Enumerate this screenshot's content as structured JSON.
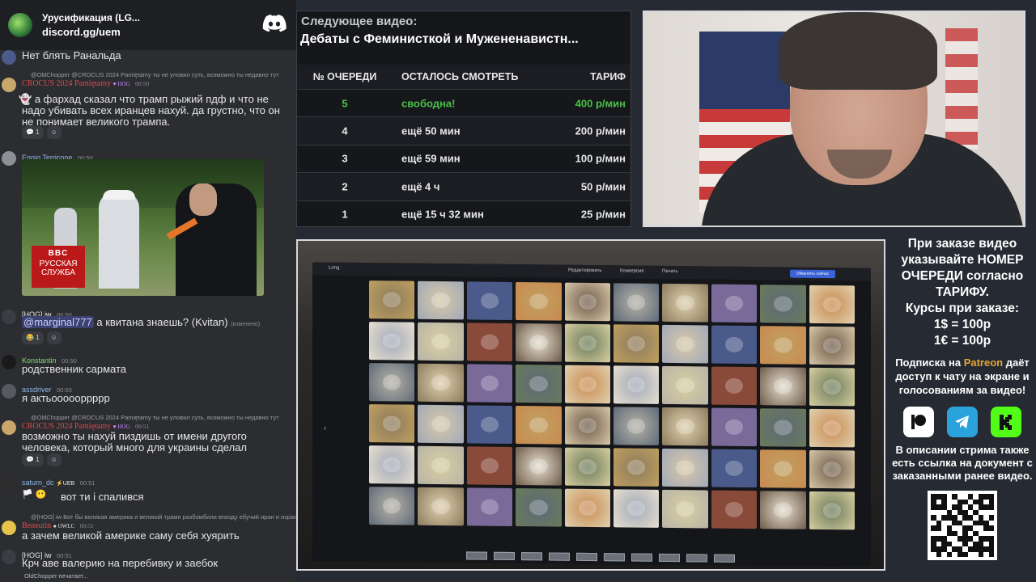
{
  "chat": {
    "server_name": "Урусификация (LG...",
    "server_link": "discord.gg/uem",
    "messages": [
      {
        "text": "Нет блять Ранальда"
      },
      {
        "reply": "@OldChopper @CROCUS 2024 Pamiętamy ты не уловил суть, возможно ты недавно тут",
        "nick": "CROCUS 2024 Pamiętamy",
        "badge": "HOG",
        "time": "00:50",
        "text": "а фархад сказал что трамп рыжий пдф и что не надо убивать всех иранцев нахуй. да грустно, что он не понимает великого трампа.",
        "reactions": [
          "1"
        ]
      },
      {
        "nick": "Ennio Terricone",
        "time": "00:50",
        "image_caption_logo": "BBC",
        "image_caption": "РУССКАЯ СЛУЖБА"
      },
      {
        "nick": "[HOG] iw",
        "time": "00:50",
        "mention": "@marginal777",
        "text": "а квитана знаешь? (Kvitan)",
        "edited": "(изменено)",
        "reactions": [
          "1"
        ]
      },
      {
        "nick": "Konstantin",
        "time": "00:50",
        "text": "родственник сармата"
      },
      {
        "nick": "assdriver",
        "time": "00:50",
        "text": "я актьоооооррррр"
      },
      {
        "reply": "@OldChopper @CROCUS 2024 Pamiętamy ты не уловил суть, возможно ты недавно тут",
        "nick": "CROCUS 2024 Pamiętamy",
        "badge": "HOG",
        "time": "00:51",
        "text": "возможно ты нахуй пиздишь от имени другого человека, который много для украины сделал",
        "reactions": [
          "1"
        ]
      },
      {
        "nick": "saturn_dc",
        "badge": "UEB",
        "time": "00:51",
        "text": "вот ти і спалився"
      },
      {
        "reply": "@[HOG] iw Вот бы великая америка и великий трамп разбомбили впизду ебучий иран и израиль",
        "nick": "Beneutin",
        "badge": "OWLC",
        "time": "00:51",
        "text": "а зачем великой америке саму себя хуярить"
      },
      {
        "nick": "[HOG] iw",
        "time": "00:51",
        "text": "Крч аве валерию на перебивку и заебок"
      }
    ],
    "typing": "OldChopper печатает..."
  },
  "queue": {
    "label": "Следующее видео:",
    "title": "Дебаты с Феминисткой и Мужененавистн...",
    "headers": [
      "№ ОЧЕРЕДИ",
      "ОСТАЛОСЬ СМОТРЕТЬ",
      "ТАРИФ"
    ],
    "rows": [
      {
        "num": "5",
        "left": "свободна!",
        "price": "400 р/мин"
      },
      {
        "num": "4",
        "left": "ещё 50 мин",
        "price": "200 р/мин"
      },
      {
        "num": "3",
        "left": "ещё 59 мин",
        "price": "100 р/мин"
      },
      {
        "num": "2",
        "left": "ещё 4 ч",
        "price": "50 р/мин"
      },
      {
        "num": "1",
        "left": "ещё 15 ч 32 мин",
        "price": "25 р/мин"
      }
    ],
    "highlight_color": "#49c147"
  },
  "screen": {
    "app_title": "Long",
    "toolbar": [
      "Редактировать",
      "Конверсия",
      "Печать"
    ],
    "action_button": "Обменять сейчас"
  },
  "info": {
    "line1": "При заказе видео указывайте НОМЕР ОЧЕРЕДИ согласно ТАРИФУ.",
    "rates_title": "Курсы при заказе:",
    "rate_usd": "1$ = 100р",
    "rate_eur": "1€ = 100р",
    "sub_pre": "Подписка на",
    "sub_patreon": "Patreon",
    "sub_post": "даёт доступ к чату на экране и голосованиям за видео!",
    "doc_note": "В описании стрима также есть ссылка на документ с заказанными ранее видео.",
    "icons": [
      "patreon-icon",
      "telegram-icon",
      "kick-icon"
    ]
  }
}
